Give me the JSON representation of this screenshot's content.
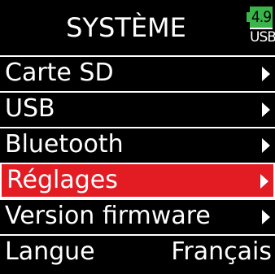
{
  "header": {
    "title": "SYSTÈME",
    "battery": {
      "value": "4.9",
      "source": "USB",
      "color": "#3ab54a"
    }
  },
  "menu": {
    "items": [
      {
        "label": "Carte SD",
        "arrow": true
      },
      {
        "label": "USB",
        "arrow": true
      },
      {
        "label": "Bluetooth",
        "arrow": true
      },
      {
        "label": "Réglages",
        "arrow": true,
        "selected": true
      },
      {
        "label": "Version firmware",
        "arrow": true
      },
      {
        "label": "Langue",
        "value": "Français"
      }
    ],
    "selected_color": "#e31b23"
  }
}
